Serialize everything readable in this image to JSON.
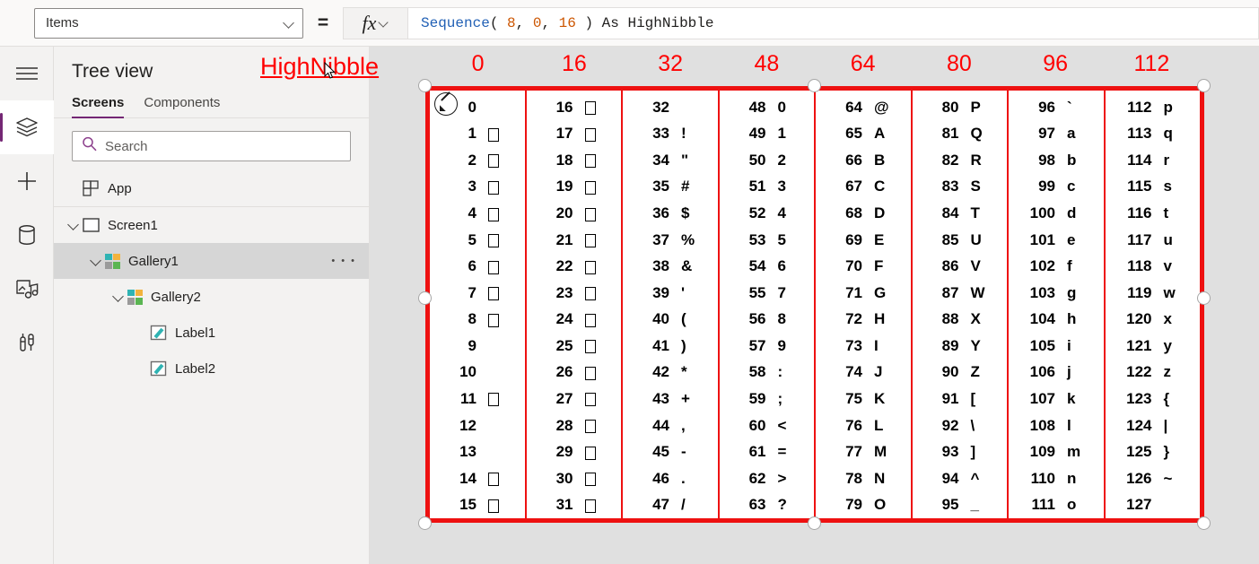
{
  "topbar": {
    "property_value": "Items",
    "equals": "=",
    "fx_label": "fx",
    "formula_tokens": [
      {
        "t": "Sequence",
        "c": "fn"
      },
      {
        "t": "( ",
        "c": "pun"
      },
      {
        "t": "8",
        "c": "num"
      },
      {
        "t": ", ",
        "c": "pun"
      },
      {
        "t": "0",
        "c": "num"
      },
      {
        "t": ", ",
        "c": "pun"
      },
      {
        "t": "16",
        "c": "num"
      },
      {
        "t": " ) ",
        "c": "pun"
      },
      {
        "t": "As HighNibble",
        "c": "id"
      }
    ],
    "formula_text": "Sequence( 8, 0, 16 ) As HighNibble"
  },
  "rail": {
    "items": [
      {
        "name": "hamburger-menu-icon",
        "selected": false
      },
      {
        "name": "tree-view-icon",
        "selected": true
      },
      {
        "name": "insert-icon",
        "selected": false
      },
      {
        "name": "data-icon",
        "selected": false
      },
      {
        "name": "media-icon",
        "selected": false
      },
      {
        "name": "advanced-tools-icon",
        "selected": false
      }
    ]
  },
  "tree": {
    "title": "Tree view",
    "tabs": [
      {
        "label": "Screens",
        "active": true
      },
      {
        "label": "Components",
        "active": false
      }
    ],
    "search": {
      "placeholder": "Search",
      "value": ""
    },
    "nodes": [
      {
        "label": "App",
        "indent": 0,
        "icon": "app",
        "twisty": false,
        "selected": false,
        "ellipsis": false
      },
      {
        "label": "Screen1",
        "indent": 0,
        "icon": "screen",
        "twisty": true,
        "selected": false,
        "ellipsis": false
      },
      {
        "label": "Gallery1",
        "indent": 1,
        "icon": "gallery",
        "twisty": true,
        "selected": true,
        "ellipsis": true
      },
      {
        "label": "Gallery2",
        "indent": 2,
        "icon": "gallery",
        "twisty": true,
        "selected": false,
        "ellipsis": false
      },
      {
        "label": "Label1",
        "indent": 3,
        "icon": "label",
        "twisty": false,
        "selected": false,
        "ellipsis": false
      },
      {
        "label": "Label2",
        "indent": 3,
        "icon": "label",
        "twisty": false,
        "selected": false,
        "ellipsis": false
      }
    ]
  },
  "canvas": {
    "highnibble_label": "HighNibble",
    "column_headers": [
      "0",
      "16",
      "32",
      "48",
      "64",
      "80",
      "96",
      "112"
    ],
    "accent_red": "#ee1111",
    "label_red": "#ff0000",
    "columns": [
      {
        "rows": [
          {
            "code": "0",
            "char": ""
          },
          {
            "code": "1",
            "char": "□"
          },
          {
            "code": "2",
            "char": "□"
          },
          {
            "code": "3",
            "char": "□"
          },
          {
            "code": "4",
            "char": "□"
          },
          {
            "code": "5",
            "char": "□"
          },
          {
            "code": "6",
            "char": "□"
          },
          {
            "code": "7",
            "char": "□"
          },
          {
            "code": "8",
            "char": "□"
          },
          {
            "code": "9",
            "char": ""
          },
          {
            "code": "10",
            "char": ""
          },
          {
            "code": "11",
            "char": "□"
          },
          {
            "code": "12",
            "char": ""
          },
          {
            "code": "13",
            "char": ""
          },
          {
            "code": "14",
            "char": "□"
          },
          {
            "code": "15",
            "char": "□"
          }
        ]
      },
      {
        "rows": [
          {
            "code": "16",
            "char": "□"
          },
          {
            "code": "17",
            "char": "□"
          },
          {
            "code": "18",
            "char": "□"
          },
          {
            "code": "19",
            "char": "□"
          },
          {
            "code": "20",
            "char": "□"
          },
          {
            "code": "21",
            "char": "□"
          },
          {
            "code": "22",
            "char": "□"
          },
          {
            "code": "23",
            "char": "□"
          },
          {
            "code": "24",
            "char": "□"
          },
          {
            "code": "25",
            "char": "□"
          },
          {
            "code": "26",
            "char": "□"
          },
          {
            "code": "27",
            "char": "□"
          },
          {
            "code": "28",
            "char": "□"
          },
          {
            "code": "29",
            "char": "□"
          },
          {
            "code": "30",
            "char": "□"
          },
          {
            "code": "31",
            "char": "□"
          }
        ]
      },
      {
        "rows": [
          {
            "code": "32",
            "char": ""
          },
          {
            "code": "33",
            "char": "!"
          },
          {
            "code": "34",
            "char": "\""
          },
          {
            "code": "35",
            "char": "#"
          },
          {
            "code": "36",
            "char": "$"
          },
          {
            "code": "37",
            "char": "%"
          },
          {
            "code": "38",
            "char": "&"
          },
          {
            "code": "39",
            "char": "'"
          },
          {
            "code": "40",
            "char": "("
          },
          {
            "code": "41",
            "char": ")"
          },
          {
            "code": "42",
            "char": "*"
          },
          {
            "code": "43",
            "char": "+"
          },
          {
            "code": "44",
            "char": ","
          },
          {
            "code": "45",
            "char": "-"
          },
          {
            "code": "46",
            "char": "."
          },
          {
            "code": "47",
            "char": "/"
          }
        ]
      },
      {
        "rows": [
          {
            "code": "48",
            "char": "0"
          },
          {
            "code": "49",
            "char": "1"
          },
          {
            "code": "50",
            "char": "2"
          },
          {
            "code": "51",
            "char": "3"
          },
          {
            "code": "52",
            "char": "4"
          },
          {
            "code": "53",
            "char": "5"
          },
          {
            "code": "54",
            "char": "6"
          },
          {
            "code": "55",
            "char": "7"
          },
          {
            "code": "56",
            "char": "8"
          },
          {
            "code": "57",
            "char": "9"
          },
          {
            "code": "58",
            "char": ":"
          },
          {
            "code": "59",
            "char": ";"
          },
          {
            "code": "60",
            "char": "<"
          },
          {
            "code": "61",
            "char": "="
          },
          {
            "code": "62",
            "char": ">"
          },
          {
            "code": "63",
            "char": "?"
          }
        ]
      },
      {
        "rows": [
          {
            "code": "64",
            "char": "@"
          },
          {
            "code": "65",
            "char": "A"
          },
          {
            "code": "66",
            "char": "B"
          },
          {
            "code": "67",
            "char": "C"
          },
          {
            "code": "68",
            "char": "D"
          },
          {
            "code": "69",
            "char": "E"
          },
          {
            "code": "70",
            "char": "F"
          },
          {
            "code": "71",
            "char": "G"
          },
          {
            "code": "72",
            "char": "H"
          },
          {
            "code": "73",
            "char": "I"
          },
          {
            "code": "74",
            "char": "J"
          },
          {
            "code": "75",
            "char": "K"
          },
          {
            "code": "76",
            "char": "L"
          },
          {
            "code": "77",
            "char": "M"
          },
          {
            "code": "78",
            "char": "N"
          },
          {
            "code": "79",
            "char": "O"
          }
        ]
      },
      {
        "rows": [
          {
            "code": "80",
            "char": "P"
          },
          {
            "code": "81",
            "char": "Q"
          },
          {
            "code": "82",
            "char": "R"
          },
          {
            "code": "83",
            "char": "S"
          },
          {
            "code": "84",
            "char": "T"
          },
          {
            "code": "85",
            "char": "U"
          },
          {
            "code": "86",
            "char": "V"
          },
          {
            "code": "87",
            "char": "W"
          },
          {
            "code": "88",
            "char": "X"
          },
          {
            "code": "89",
            "char": "Y"
          },
          {
            "code": "90",
            "char": "Z"
          },
          {
            "code": "91",
            "char": "["
          },
          {
            "code": "92",
            "char": "\\"
          },
          {
            "code": "93",
            "char": "]"
          },
          {
            "code": "94",
            "char": "^"
          },
          {
            "code": "95",
            "char": "_"
          }
        ]
      },
      {
        "rows": [
          {
            "code": "96",
            "char": "`"
          },
          {
            "code": "97",
            "char": "a"
          },
          {
            "code": "98",
            "char": "b"
          },
          {
            "code": "99",
            "char": "c"
          },
          {
            "code": "100",
            "char": "d"
          },
          {
            "code": "101",
            "char": "e"
          },
          {
            "code": "102",
            "char": "f"
          },
          {
            "code": "103",
            "char": "g"
          },
          {
            "code": "104",
            "char": "h"
          },
          {
            "code": "105",
            "char": "i"
          },
          {
            "code": "106",
            "char": "j"
          },
          {
            "code": "107",
            "char": "k"
          },
          {
            "code": "108",
            "char": "l"
          },
          {
            "code": "109",
            "char": "m"
          },
          {
            "code": "110",
            "char": "n"
          },
          {
            "code": "111",
            "char": "o"
          }
        ]
      },
      {
        "rows": [
          {
            "code": "112",
            "char": "p"
          },
          {
            "code": "113",
            "char": "q"
          },
          {
            "code": "114",
            "char": "r"
          },
          {
            "code": "115",
            "char": "s"
          },
          {
            "code": "116",
            "char": "t"
          },
          {
            "code": "117",
            "char": "u"
          },
          {
            "code": "118",
            "char": "v"
          },
          {
            "code": "119",
            "char": "w"
          },
          {
            "code": "120",
            "char": "x"
          },
          {
            "code": "121",
            "char": "y"
          },
          {
            "code": "122",
            "char": "z"
          },
          {
            "code": "123",
            "char": "{"
          },
          {
            "code": "124",
            "char": "|"
          },
          {
            "code": "125",
            "char": "}"
          },
          {
            "code": "126",
            "char": "~"
          },
          {
            "code": "127",
            "char": ""
          }
        ]
      }
    ]
  }
}
